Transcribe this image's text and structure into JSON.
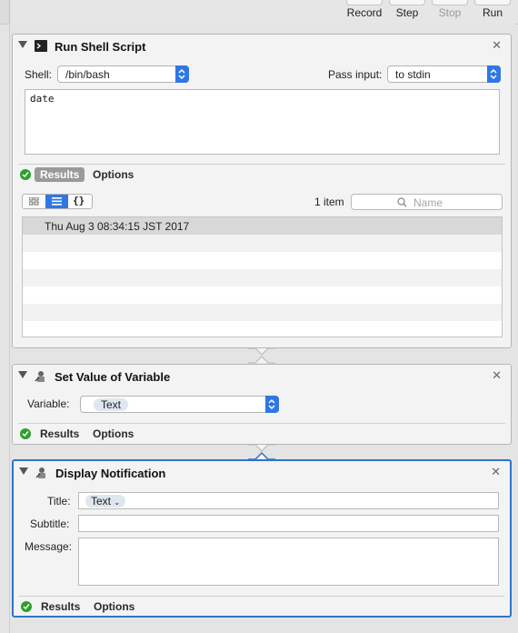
{
  "toolbar": {
    "buttons": [
      {
        "label": "Record",
        "enabled": true
      },
      {
        "label": "Step",
        "enabled": true
      },
      {
        "label": "Stop",
        "enabled": false
      },
      {
        "label": "Run",
        "enabled": true
      }
    ]
  },
  "actions": [
    {
      "title": "Run Shell Script",
      "icon": "terminal-icon",
      "shell_label": "Shell:",
      "shell_value": "/bin/bash",
      "pass_input_label": "Pass input:",
      "pass_input_value": "to stdin",
      "script": "date",
      "results_label": "Results",
      "options_label": "Options",
      "item_count": "1 item",
      "search_placeholder": "Name",
      "results": [
        "Thu Aug  3 08:34:15 JST 2017"
      ]
    },
    {
      "title": "Set Value of Variable",
      "icon": "automator-robot-icon",
      "variable_label": "Variable:",
      "variable_value": "Text",
      "results_label": "Results",
      "options_label": "Options"
    },
    {
      "title": "Display Notification",
      "icon": "automator-robot-icon",
      "title_label": "Title:",
      "title_token": "Text",
      "subtitle_label": "Subtitle:",
      "message_label": "Message:",
      "results_label": "Results",
      "options_label": "Options"
    }
  ],
  "colors": {
    "accent": "#2f78e3",
    "success": "#2ca02c",
    "selected_border": "#2f74c9"
  }
}
